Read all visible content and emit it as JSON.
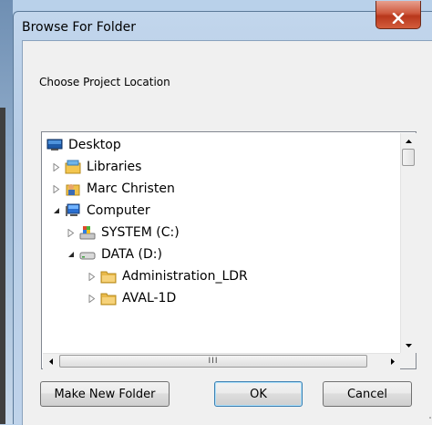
{
  "window": {
    "title": "Browse For Folder"
  },
  "prompt": "Choose Project Location",
  "tree": {
    "items": [
      {
        "label": "Desktop",
        "icon": "desktop-icon",
        "arrow": "none"
      },
      {
        "label": "Libraries",
        "icon": "libraries-icon",
        "arrow": "collapsed"
      },
      {
        "label": "Marc Christen",
        "icon": "user-folder-icon",
        "arrow": "collapsed"
      },
      {
        "label": "Computer",
        "icon": "computer-icon",
        "arrow": "expanded"
      },
      {
        "label": "SYSTEM (C:)",
        "icon": "system-drive-icon",
        "arrow": "collapsed"
      },
      {
        "label": "DATA (D:)",
        "icon": "drive-icon",
        "arrow": "expanded"
      },
      {
        "label": "Administration_LDR",
        "icon": "folder-icon",
        "arrow": "collapsed"
      },
      {
        "label": "AVAL-1D",
        "icon": "folder-icon",
        "arrow": "collapsed"
      }
    ],
    "hscroll_grip": "III"
  },
  "buttons": {
    "make_new_folder": "Make New Folder",
    "ok": "OK",
    "cancel": "Cancel"
  },
  "colors": {
    "close_button": "#c9462a",
    "default_button_border": "#3c7fb1",
    "window_frame": "#b9d1ea"
  }
}
